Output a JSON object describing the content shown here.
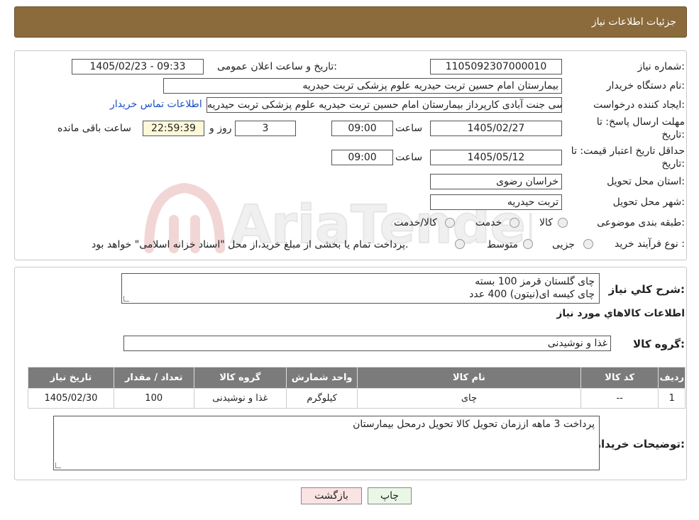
{
  "header": {
    "title": "جزئیات اطلاعات نیاز"
  },
  "form": {
    "need_number_label": "شماره نیاز:",
    "need_number": "1105092307000010",
    "announce_label": "تاریخ و ساعت اعلان عمومی:",
    "announce_value": "1405/02/23 - 09:33",
    "buyer_label": "نام دستگاه خریدار:",
    "buyer_value": "بیمارستان امام حسین تربت حیدریه   علوم پزشکی تربت حیدریه",
    "creator_label": "ایجاد کننده درخواست:",
    "creator_value": "جلال عباسی جنت آبادی کارپرداز بیمارستان امام حسین تربت حیدریه   علوم پزشکی تربت حیدریه",
    "contact_link": "اطلاعات تماس خریدار",
    "deadline_label_1": "مهلت ارسال پاسخ: تا",
    "deadline_label_2": "تاریخ:",
    "deadline_date": "1405/02/27",
    "time_word": "ساعت",
    "deadline_time": "09:00",
    "days_value": "3",
    "days_word": "روز و",
    "remaining_time": "22:59:39",
    "remaining_word": "ساعت باقی مانده",
    "validity_label_1": "حداقل تاریخ اعتبار قیمت: تا",
    "validity_label_2": "تاریخ:",
    "validity_date": "1405/05/12",
    "validity_time": "09:00",
    "province_label": "استان محل تحویل:",
    "province_value": "خراسان رضوی",
    "city_label": "شهر محل تحویل:",
    "city_value": "تربت حیدریه",
    "category_label": "طبقه بندی موضوعی:",
    "category_options": [
      "کالا",
      "خدمت",
      "کالا/خدمت"
    ],
    "process_label": "نوع فرآیند خرید :",
    "process_options": [
      "جزیی",
      "متوسط"
    ],
    "process_note": "پرداخت تمام یا بخشی از مبلغ خرید،از محل \"اسناد خزانه اسلامی\" خواهد بود."
  },
  "summary": {
    "label": "شرح کلي نياز:",
    "lines": [
      "چای گلستان قرمز   100 بسته",
      "چای کیسه ای(نیتون) 400 عدد"
    ]
  },
  "goods": {
    "section_title": "اطلاعات کالاهاي مورد نياز",
    "group_label": "گروه کالا:",
    "group_value": "غذا و نوشیدنی",
    "columns": [
      "ردیف",
      "کد کالا",
      "نام کالا",
      "واحد شمارش",
      "گروه کالا",
      "تعداد / مقدار",
      "تاریخ نیاز"
    ],
    "rows": [
      [
        "1",
        "--",
        "چای",
        "کیلوگرم",
        "غذا و نوشیدنی",
        "100",
        "1405/02/30"
      ]
    ]
  },
  "buyer_notes": {
    "label": "توضیحات خریدار:",
    "text": "پرداخت 3 ماهه اززمان تحویل کالا تحویل درمحل بیمارستان"
  },
  "buttons": {
    "print": "چاپ",
    "back": "بازگشت"
  },
  "watermark": {
    "text": "AriaTender.neT"
  }
}
